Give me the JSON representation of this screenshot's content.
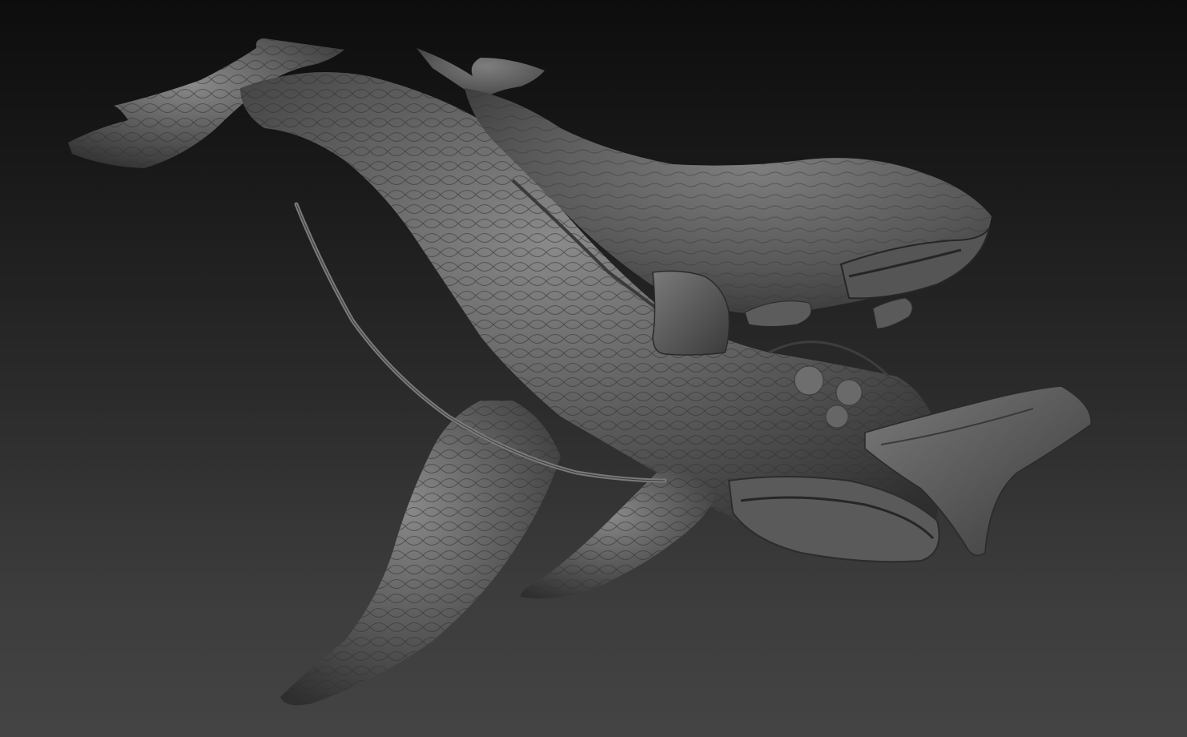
{
  "viewport": {
    "background_top": "#0d0d0d",
    "background_bottom": "#444444",
    "material_color": "#6a6a6a"
  },
  "scene": {
    "subject_icon": "sculpted-whale-model-icon",
    "objects": [
      "large-whale-model",
      "small-whale-model",
      "fishing-rod-model"
    ]
  }
}
